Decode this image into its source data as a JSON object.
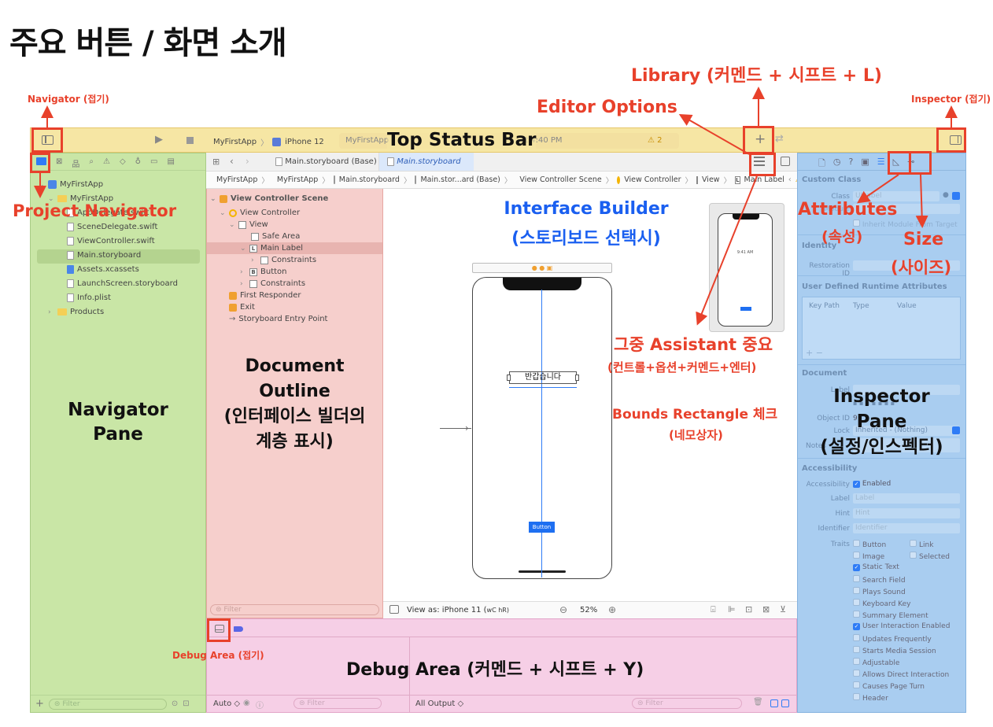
{
  "page_title": "주요 버튼 / 화면 소개",
  "annotations": {
    "navigator_collapse": "Navigator (접기)",
    "inspector_collapse": "Inspector (접기)",
    "library": "Library (커멘드 + 시프트 + L)",
    "editor_options": "Editor Options",
    "top_status_bar": "Top Status Bar",
    "project_navigator": "Project Navigator",
    "interface_builder": "Interface Builder",
    "interface_builder_sub": "(스토리보드 선택시)",
    "attributes": "Attributes",
    "attributes_sub": "(속성)",
    "size": "Size",
    "size_sub": "(사이즈)",
    "assistant": "그중 Assistant 중요",
    "assistant_sub": "(컨트롤+옵션+커멘드+엔터)",
    "bounds": "Bounds Rectangle 체크",
    "bounds_sub": "(네모상자)",
    "document_outline_1": "Document",
    "document_outline_2": "Outline",
    "document_outline_3": "(인터페이스 빌더의",
    "document_outline_4": "계층 표시)",
    "navigator_pane_1": "Navigator",
    "navigator_pane_2": "Pane",
    "inspector_pane_1": "Inspector",
    "inspector_pane_2": "Pane",
    "inspector_pane_3": "(설정/인스펙터)",
    "debug_area": "Debug Area (커멘드 + 시프트 + Y)",
    "debug_collapse": "Debug Area (접기)"
  },
  "toolbar": {
    "scheme": "MyFirstApp",
    "device": "iPhone 12",
    "status_app": "MyFirstApp",
    "status_time": "at 4:40 PM",
    "warning_count": "2",
    "plus": "+"
  },
  "tabs": [
    {
      "label": "Main.storyboard (Base)"
    },
    {
      "label": "Main.storyboard"
    }
  ],
  "jumpbar": [
    "MyFirstApp",
    "MyFirstApp",
    "Main.storyboard",
    "Main.stor...ard (Base)",
    "View Controller Scene",
    "View Controller",
    "View",
    "Main Label"
  ],
  "navigator": {
    "project": "MyFirstApp",
    "group": "MyFirstApp",
    "files": [
      "AppDelegate.swift",
      "SceneDelegate.swift",
      "ViewController.swift",
      "Main.storyboard",
      "Assets.xcassets",
      "LaunchScreen.storyboard",
      "Info.plist"
    ],
    "products": "Products",
    "filter": "Filter"
  },
  "outline": {
    "scene": "View Controller Scene",
    "vc": "View Controller",
    "view": "View",
    "safe_area": "Safe Area",
    "main_label": "Main Label",
    "constraints_1": "Constraints",
    "button": "Button",
    "constraints_2": "Constraints",
    "first_responder": "First Responder",
    "exit": "Exit",
    "entry": "Storyboard Entry Point",
    "filter": "Filter"
  },
  "canvas": {
    "label_text": "반갑습니다",
    "button_text": "Button",
    "view_as": "View as: iPhone 11 (",
    "view_as_traits": "wC hR)",
    "zoom": "52%",
    "mini_time": "9:41 AM"
  },
  "debug": {
    "auto": "Auto ◇",
    "all_output": "All Output ◇",
    "filter_1": "Filter",
    "filter_2": "Filter"
  },
  "inspector": {
    "custom_class": "Custom Class",
    "class_label": "Class",
    "class_value": "UILabel",
    "module_label": "Module",
    "inherit": "Inherit Module From Target",
    "identity": "Identity",
    "restoration_id": "Restoration ID",
    "udra": "User Defined Runtime Attributes",
    "col_keypath": "Key Path",
    "col_type": "Type",
    "col_value": "Value",
    "add_remove": "+ −",
    "document": "Document",
    "doc_label": "Label",
    "object_id": "Object ID",
    "object_id_value": "9",
    "lock": "Lock",
    "lock_value": "Inherited - (Nothing)",
    "notes": "Notes",
    "accessibility": "Accessibility",
    "acc_label": "Accessibility",
    "acc_enabled": "Enabled",
    "label_label": "Label",
    "label_ph": "Label",
    "hint_label": "Hint",
    "hint_ph": "Hint",
    "identifier_label": "Identifier",
    "identifier_ph": "Identifier",
    "traits_label": "Traits",
    "traits": [
      {
        "name": "Button",
        "checked": false
      },
      {
        "name": "Link",
        "checked": false
      },
      {
        "name": "Image",
        "checked": false
      },
      {
        "name": "Selected",
        "checked": false
      },
      {
        "name": "Static Text",
        "checked": true
      },
      {
        "name": "Search Field",
        "checked": false
      },
      {
        "name": "Plays Sound",
        "checked": false
      },
      {
        "name": "Keyboard Key",
        "checked": false
      },
      {
        "name": "Summary Element",
        "checked": false
      },
      {
        "name": "User Interaction Enabled",
        "checked": true
      },
      {
        "name": "Updates Frequently",
        "checked": false
      },
      {
        "name": "Starts Media Session",
        "checked": false
      },
      {
        "name": "Adjustable",
        "checked": false
      },
      {
        "name": "Allows Direct Interaction",
        "checked": false
      },
      {
        "name": "Causes Page Turn",
        "checked": false
      },
      {
        "name": "Header",
        "checked": false
      }
    ]
  },
  "colors": {
    "annotation_red": "#e8412b",
    "ib_blue": "#1a5ff0",
    "toolbar_yellow": "#f6e6a4",
    "navigator_green": "#c9e6a6",
    "outline_pink": "#f6cfcc",
    "debug_pink": "#f6cfe6",
    "inspector_blue": "#a9cdf0"
  }
}
